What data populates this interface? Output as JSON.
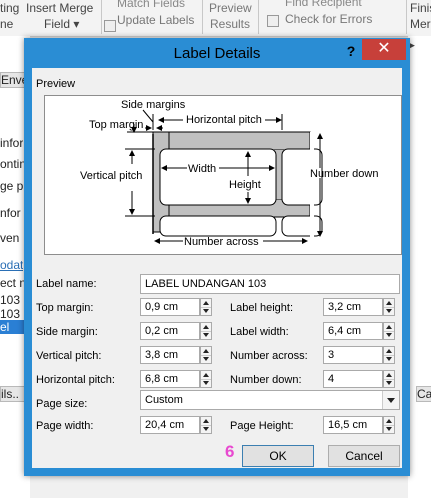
{
  "ribbon": {
    "items": [
      {
        "text": "ting",
        "text2": "ne"
      },
      {
        "text": "Insert Merge",
        "text2": "Field ▾"
      },
      {
        "text": "Match Fields",
        "text2": "Update Labels"
      },
      {
        "text": "Preview",
        "text2": "Results"
      },
      {
        "text": "Find Recipient",
        "text2": "Check for Errors"
      },
      {
        "text": "Finis",
        "text2": "Merg"
      }
    ]
  },
  "background_lines": [
    "Enve",
    "infor",
    "ontin",
    "ge p",
    "nfor",
    "ven",
    "odat",
    "ect n",
    "103",
    "103",
    "el",
    "ils.."
  ],
  "background_right_lines": [
    "▶",
    "Ca"
  ],
  "dialog": {
    "title": "Label Details",
    "help": "?",
    "close": "✕",
    "preview_label": "Preview",
    "diagram": {
      "side_margins": "Side margins",
      "top_margin": "Top margin",
      "horizontal_pitch": "Horizontal pitch",
      "vertical_pitch": "Vertical pitch",
      "width": "Width",
      "height": "Height",
      "number_down": "Number down",
      "number_across": "Number across"
    },
    "label_name": {
      "label": "Label name:",
      "value": "LABEL UNDANGAN 103"
    },
    "fields": {
      "top_margin": {
        "label": "Top margin:",
        "value": "0,9 cm"
      },
      "label_height": {
        "label": "Label height:",
        "value": "3,2 cm"
      },
      "side_margin": {
        "label": "Side margin:",
        "value": "0,2 cm"
      },
      "label_width": {
        "label": "Label width:",
        "value": "6,4 cm"
      },
      "vertical_pitch": {
        "label": "Vertical pitch:",
        "value": "3,8 cm"
      },
      "number_across": {
        "label": "Number across:",
        "value": "3"
      },
      "horizontal_pitch": {
        "label": "Horizontal pitch:",
        "value": "6,8 cm"
      },
      "number_down": {
        "label": "Number down:",
        "value": "4"
      },
      "page_width": {
        "label": "Page width:",
        "value": "20,4 cm"
      },
      "page_height": {
        "label": "Page Height:",
        "value": "16,5 cm"
      }
    },
    "page_size": {
      "label": "Page size:",
      "value": "Custom"
    },
    "ok": "OK",
    "cancel": "Cancel",
    "step_badge": "6"
  }
}
